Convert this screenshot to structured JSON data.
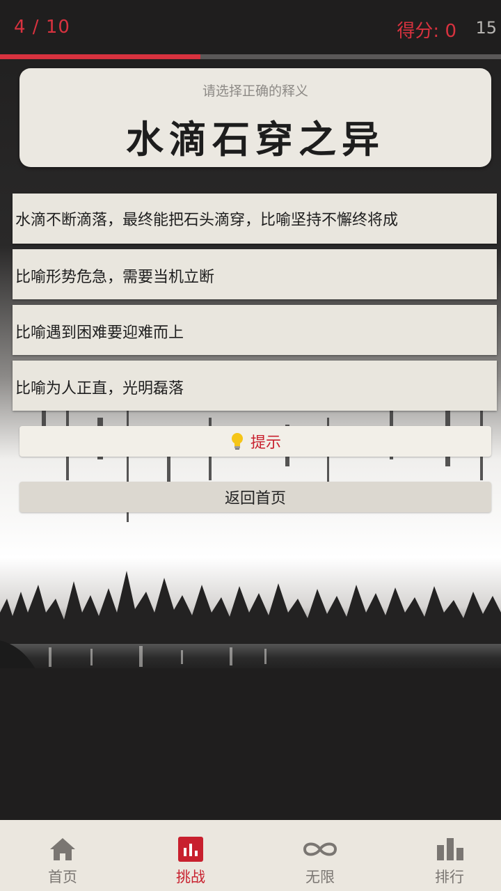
{
  "header": {
    "progress_text": "4 / 10",
    "score_text": "得分: 0",
    "timer_text": "15",
    "progress_fraction": 0.4
  },
  "question": {
    "prompt": "请选择正确的释义",
    "word": "水滴石穿之异"
  },
  "options": [
    {
      "label": "水滴不断滴落，最终能把石头滴穿，比喻坚持不懈终将成"
    },
    {
      "label": "比喻形势危急，需要当机立断"
    },
    {
      "label": "比喻遇到困难要迎难而上"
    },
    {
      "label": "比喻为人正直，光明磊落"
    }
  ],
  "buttons": {
    "hint_label": "提示",
    "home_label": "返回首页"
  },
  "nav": [
    {
      "label": "首页",
      "icon": "home-icon"
    },
    {
      "label": "挑战",
      "icon": "chart-box-icon",
      "active": true
    },
    {
      "label": "无限",
      "icon": "infinity-icon"
    },
    {
      "label": "排行",
      "icon": "bar-chart-icon"
    }
  ],
  "colors": {
    "accent": "#d8323f",
    "background": "#1f1e1e",
    "card": "#ebe8e1",
    "nav_bg": "#ebe7df"
  }
}
